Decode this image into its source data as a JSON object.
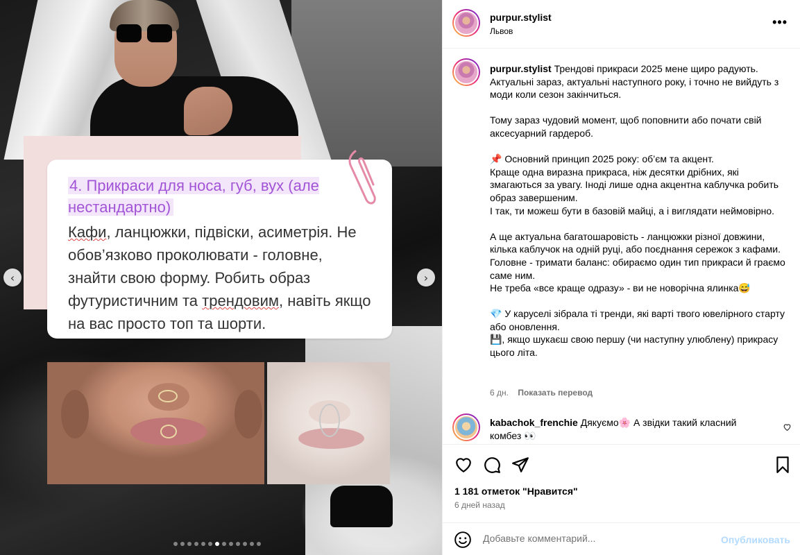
{
  "post": {
    "username": "purpur.stylist",
    "location": "Львов",
    "more_icon": "more-horizontal-icon"
  },
  "media": {
    "card_title": "4. Прикраси для носа, губ, вух (але нестандартно)",
    "card_body_1": "Кафи",
    "card_body_2": ", ланцюжки, підвіски, асиметрія. Не обов’язково проколювати - головне, знайти свою форму. Робить образ футуристичним та ",
    "card_body_3": "трендовим",
    "card_body_4": ", навіть якщо на вас просто топ та шорти.",
    "prev_icon": "chevron-left-icon",
    "next_icon": "chevron-right-icon",
    "carousel_count": 13,
    "carousel_active": 6
  },
  "caption": {
    "username": "purpur.stylist",
    "text": " Трендові прикраси 2025 мене щиро радують. Актуальні зараз, актуальні наступного року, і точно не вийдуть з моди коли сезон закінчиться.\n\nТому зараз чудовий момент, щоб поповнити або почати свій аксесуарний гардероб.\n\n📌 Основний принцип 2025 року: об’єм та акцент.\nКраще одна виразна прикраса, ніж десятки дрібних, які змагаються за увагу. Іноді лише одна акцентна каблучка робить образ завершеним.\nІ так, ти можеш бути в базовій майці, а і виглядати неймовірно.\n\nА ще актуальна багатошаровість - ланцюжки різної довжини, кілька каблучок на одній руці, або поєднання сережок з кафами.\nГоловне - тримати баланс: обираємо один тип прикраси й граємо саме ним.\nНе треба «все краще одразу» - ви не новорічна ялинка😅\n\n💎 У каруселі зібрала ті тренди, які варті твого ювелірного старту або оновлення.\n💾, якщо шукаєш свою першу (чи наступну улюблену) прикрасу цього літа.",
    "age": "6 дн.",
    "translate": "Показать перевод"
  },
  "comment": {
    "username": "kabachok_frenchie",
    "text": " Дякуємо🌸  А звідки такий класний комбез 👀"
  },
  "actions": {
    "like_icon": "heart-icon",
    "comment_icon": "comment-icon",
    "share_icon": "send-icon",
    "save_icon": "bookmark-icon",
    "likes": "1 181 отметок \"Нравится\"",
    "date": "6 дней назад"
  },
  "add_comment": {
    "emoji_icon": "smiley-icon",
    "placeholder": "Добавьте комментарий...",
    "publish": "Опубликовать"
  },
  "colors": {
    "accent_purple": "#a254d6",
    "publish_disabled": "#b3dbff",
    "muted": "#737373"
  }
}
